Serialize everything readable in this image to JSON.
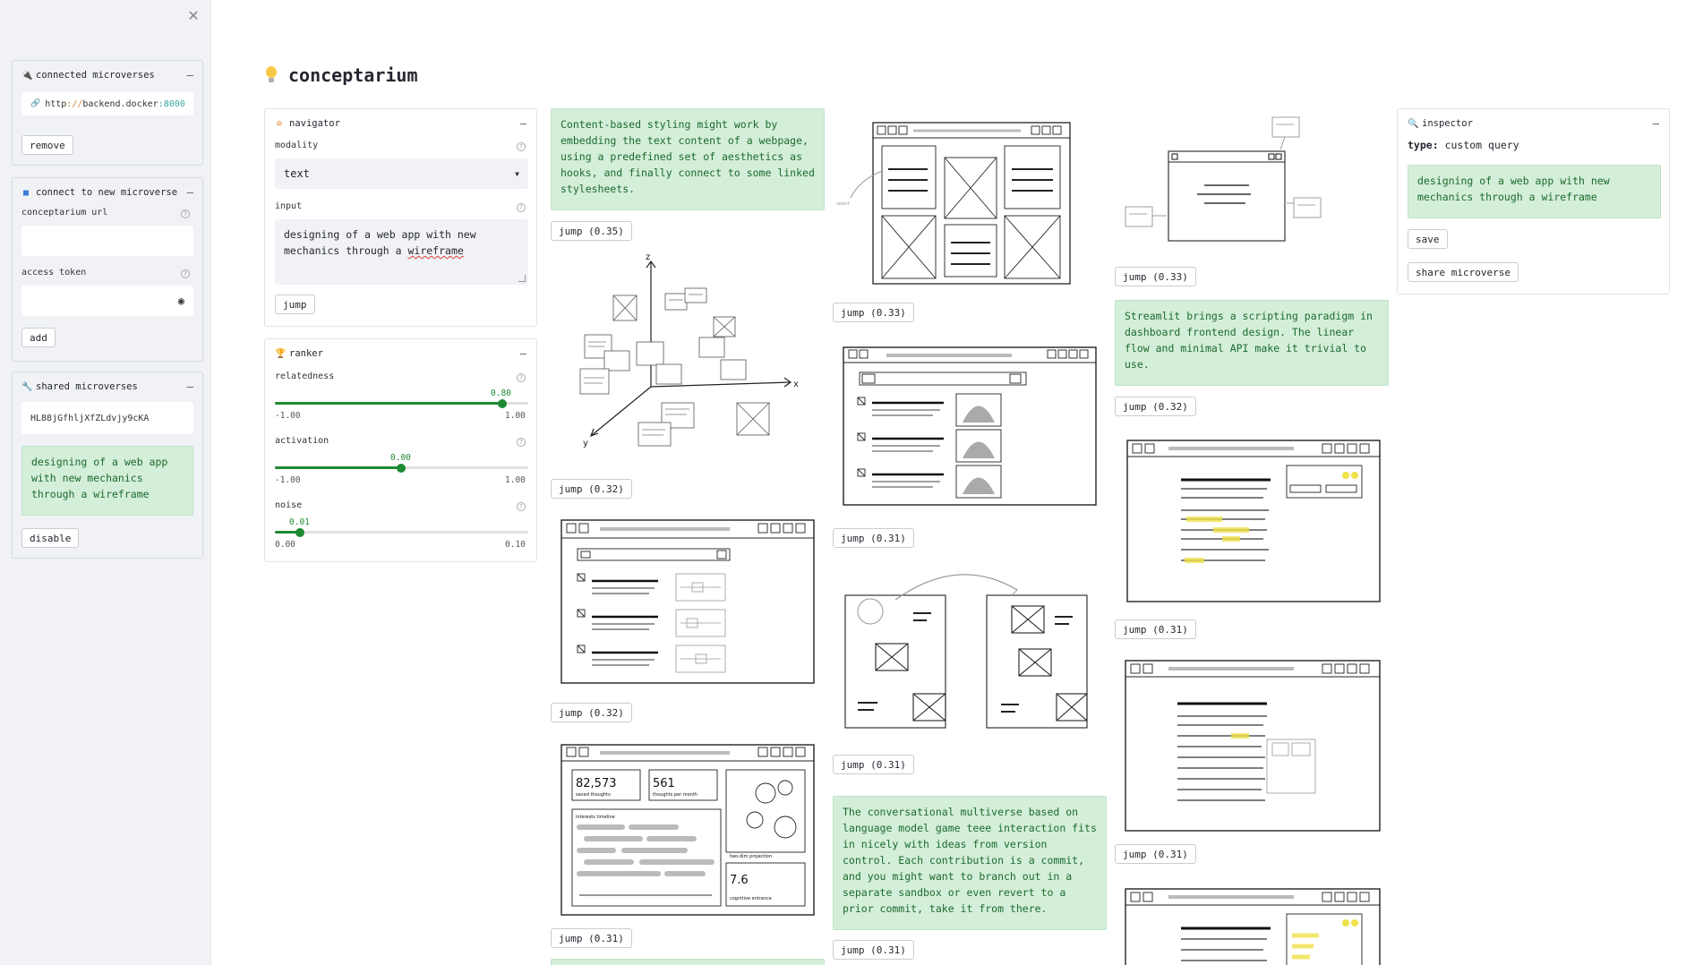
{
  "sidebar": {
    "close_icon": "close-icon",
    "connected": {
      "title": "connected microverses",
      "url_scheme": "http",
      "url_sep": "://",
      "url_host": "backend.docker",
      "url_colon": ":",
      "url_port": "8000",
      "remove_label": "remove"
    },
    "connect_new": {
      "title": "connect to new microverse",
      "url_label": "conceptarium url",
      "url_value": "",
      "token_label": "access token",
      "token_value": "",
      "add_label": "add"
    },
    "shared": {
      "title": "shared microverses",
      "token": "HL88jGfhljXfZLdvjy9cKA",
      "query": "designing of a web app with new mechanics through a wireframe",
      "disable_label": "disable"
    }
  },
  "main": {
    "title": "conceptarium",
    "navigator": {
      "title": "navigator",
      "modality_label": "modality",
      "modality_value": "text",
      "input_label": "input",
      "input_text_a": "designing of a web app with new mechanics through a ",
      "input_text_b": "wireframe",
      "jump_label": "jump"
    },
    "ranker": {
      "title": "ranker",
      "sliders": [
        {
          "label": "relatedness",
          "value": 0.8,
          "value_text": "0.80",
          "min": "-1.00",
          "max": "1.00"
        },
        {
          "label": "activation",
          "value": 0.0,
          "value_text": "0.00",
          "min": "-1.00",
          "max": "1.00"
        },
        {
          "label": "noise",
          "value": 0.01,
          "value_text": "0.01",
          "min": "0.00",
          "max": "0.10"
        }
      ]
    },
    "inspector": {
      "title": "inspector",
      "type_label": "type:",
      "type_value": "custom query",
      "query": "designing of a web app with new mechanics through a wireframe",
      "save_label": "save",
      "share_label": "share microverse"
    },
    "results": {
      "col1": {
        "text1": "Content-based styling might work by embedding the text content of a webpage, using a predefined set of aesthetics as hooks, and finally connect to some linked stylesheets.",
        "jump1": "jump (0.35)",
        "jump2": "jump (0.32)",
        "jump3": "jump (0.32)",
        "jump4": "jump (0.31)"
      },
      "col2": {
        "jump1": "jump (0.33)",
        "jump2": "jump (0.31)",
        "jump3": "jump (0.31)",
        "text1": "The conversational multiverse based on language model game teee interaction fits in nicely with ideas from version control. Each contribution is a commit, and you might want to branch out in a separate sandbox or even revert to a prior commit, take it from there.",
        "jump4": "jump (0.31)"
      },
      "col3": {
        "jump1": "jump (0.33)",
        "text1": "Streamlit brings a scripting paradigm in dashboard frontend design. The linear flow and minimal API make it trivial to use.",
        "jump2": "jump (0.32)",
        "jump3": "jump (0.31)",
        "jump4": "jump (0.31)"
      },
      "sketch_dashboard": {
        "stat1": "82,573",
        "stat1_caption": "saved thoughts",
        "stat2": "561",
        "stat2_caption": "thoughts per month",
        "timeline": "interests timeline",
        "projection": "two-dim projection",
        "stat3": "7.6",
        "stat3_caption": "cognitive entrance"
      }
    }
  },
  "colors": {
    "accent_green": "#1e8a34",
    "green_box_bg": "#d3eed9",
    "green_box_text": "#1d6a2f",
    "sidebar_bg": "#f0f2f6"
  }
}
